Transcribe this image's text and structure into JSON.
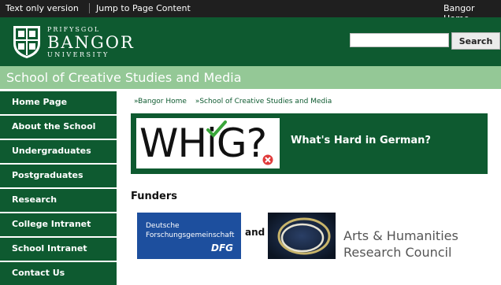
{
  "topbar": {
    "text_only": "Text only version",
    "jump": "Jump to Page Content",
    "home": "Bangor Home"
  },
  "logo": {
    "line1": "PRIFYSGOL",
    "line2": "BANGOR",
    "line3": "UNIVERSITY"
  },
  "search": {
    "value": "",
    "button": "Search"
  },
  "school": {
    "title": "School of Creative Studies and Media"
  },
  "nav": {
    "items": [
      "Home Page",
      "About the School",
      "Undergraduates",
      "Postgraduates",
      "Research",
      "College Intranet",
      "School Intranet",
      "Contact Us"
    ]
  },
  "breadcrumb": {
    "items": [
      "»Bangor Home",
      "»School of Creative Studies and Media"
    ]
  },
  "banner": {
    "logo_text": "WHiG?",
    "title": "What's Hard in German?"
  },
  "funders": {
    "heading": "Funders",
    "dfg_line1": "Deutsche",
    "dfg_line2": "Forschungsgemeinschaft",
    "dfg_line3": "DFG",
    "and": "and",
    "ahrc_line1": "Arts & Humanities",
    "ahrc_line2": "Research Council"
  },
  "colors": {
    "brand_green": "#0e5a30",
    "light_green": "#94c896",
    "top_bar": "#1f1f1f",
    "dfg_blue": "#1d4f9e"
  }
}
